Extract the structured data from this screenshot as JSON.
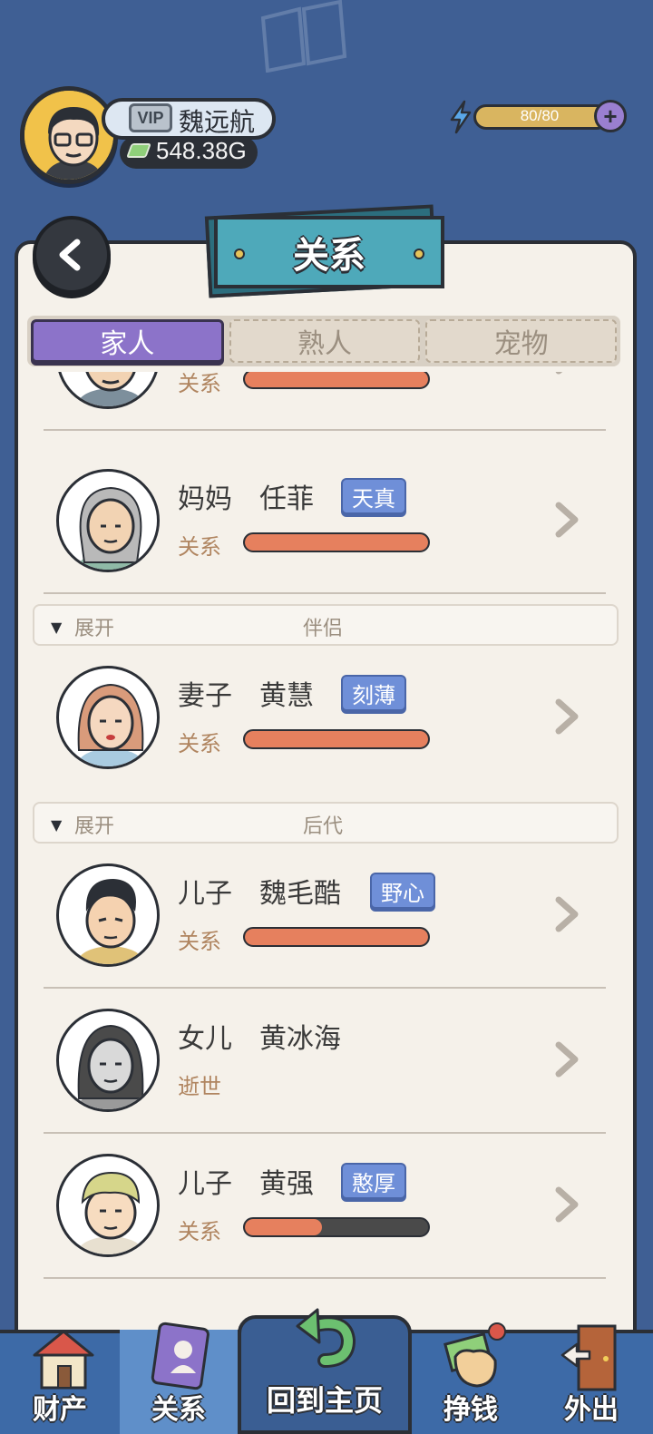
{
  "header": {
    "vip_label": "VIP",
    "player_name": "魏远航",
    "money": "548.38G",
    "energy": "80/80"
  },
  "page": {
    "title": "关系"
  },
  "tabs": [
    {
      "label": "家人",
      "active": true
    },
    {
      "label": "熟人",
      "active": false
    },
    {
      "label": "宠物",
      "active": false
    }
  ],
  "groups": {
    "expand_label": "展开",
    "partner": "伴侣",
    "offspring": "后代"
  },
  "rows": [
    {
      "role": "",
      "name": "",
      "trait": "",
      "status": "关系",
      "relationship": 1.0
    },
    {
      "role": "妈妈",
      "name": "任菲",
      "trait": "天真",
      "status": "关系",
      "relationship": 1.0
    },
    {
      "role": "妻子",
      "name": "黄慧",
      "trait": "刻薄",
      "status": "关系",
      "relationship": 1.0
    },
    {
      "role": "儿子",
      "name": "魏毛酷",
      "trait": "野心",
      "status": "关系",
      "relationship": 1.0
    },
    {
      "role": "女儿",
      "name": "黄冰海",
      "trait": "",
      "status": "逝世",
      "relationship": null
    },
    {
      "role": "儿子",
      "name": "黄强",
      "trait": "憨厚",
      "status": "关系",
      "relationship": 0.42
    }
  ],
  "bottom_nav": {
    "assets": "财产",
    "relations": "关系",
    "home": "回到主页",
    "earn": "挣钱",
    "outing": "外出"
  },
  "colors": {
    "background": "#3f5f94",
    "tab_active": "#8c73c9",
    "trait_badge": "#6f8fd8",
    "relationship_bar": "#e6805e",
    "title_card": "#4ea9ba"
  }
}
